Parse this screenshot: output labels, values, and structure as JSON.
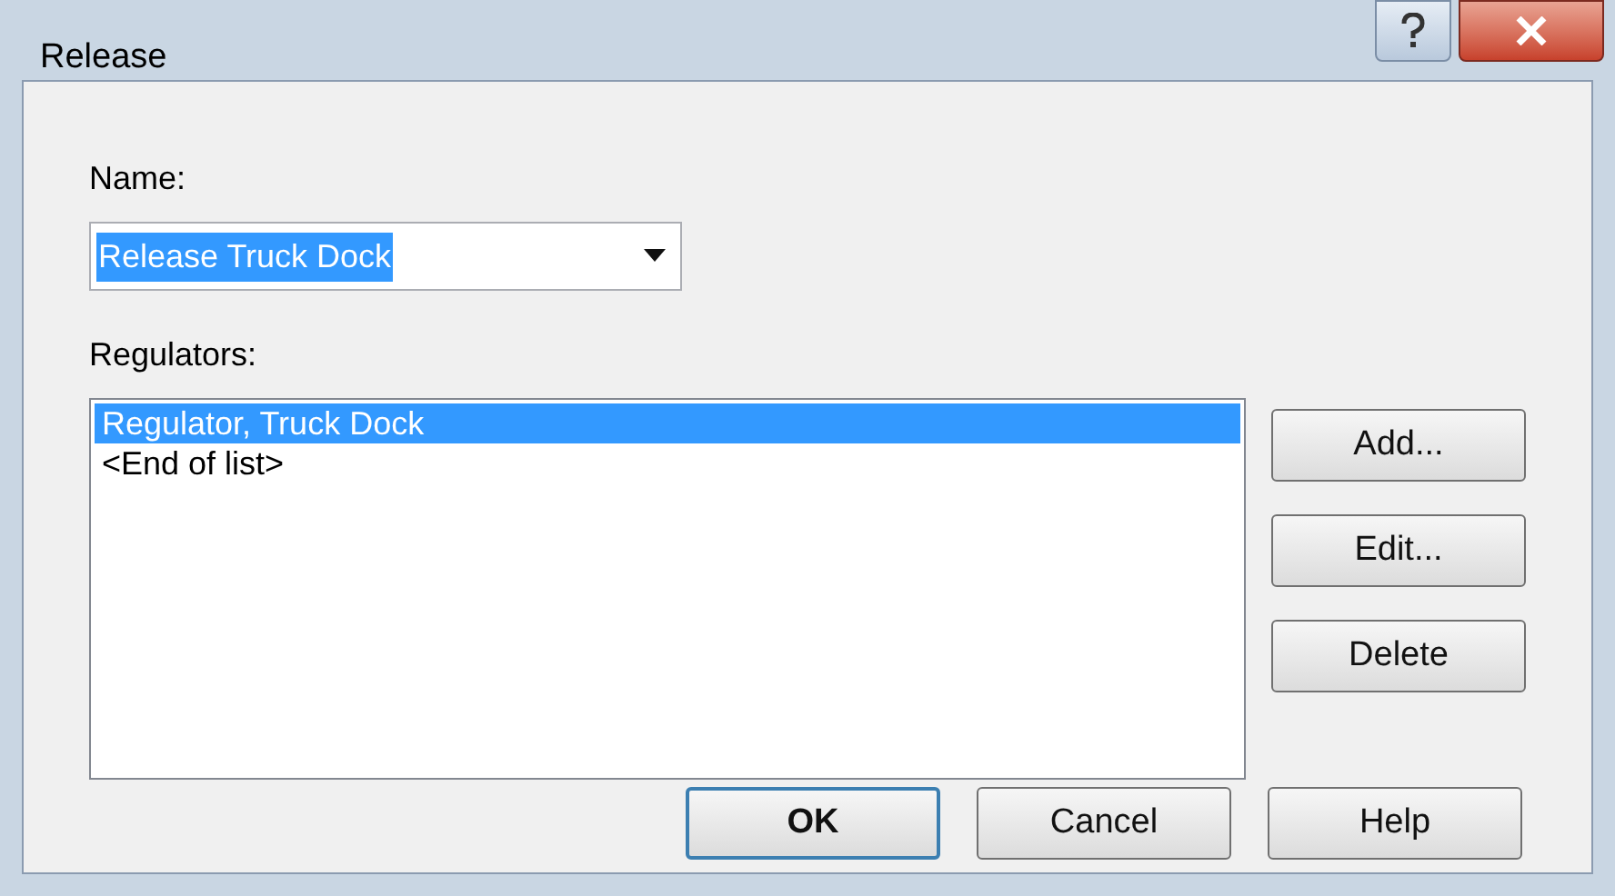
{
  "window": {
    "title": "Release"
  },
  "name_field": {
    "label": "Name:",
    "value": "Release Truck Dock"
  },
  "regulators": {
    "label": "Regulators:",
    "items": [
      {
        "text": "Regulator, Truck Dock",
        "selected": true
      },
      {
        "text": "<End of list>",
        "selected": false
      }
    ]
  },
  "side_buttons": [
    "Add...",
    "Edit...",
    "Delete"
  ],
  "footer_buttons": [
    {
      "label": "OK",
      "default": true
    },
    {
      "label": "Cancel",
      "default": false
    },
    {
      "label": "Help",
      "default": false
    }
  ]
}
